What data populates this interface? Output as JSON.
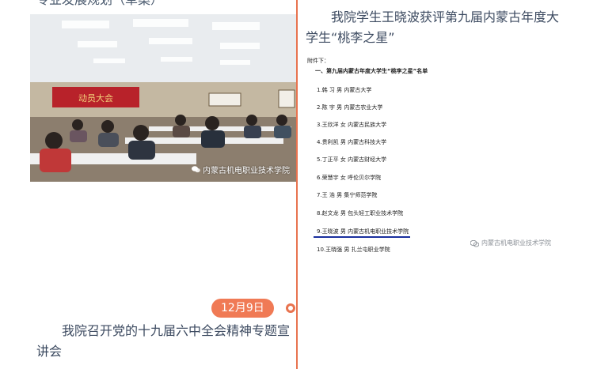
{
  "left_top_clipped_title": "专业发展规划（草案）",
  "left_photo": {
    "watermark": "内蒙古机电职业技术学院",
    "banner_text": "动员大会"
  },
  "right_news": {
    "title": "我院学生王晓波获评第九届内蒙古年度大学生“桃李之星”"
  },
  "document": {
    "header": "附件下：",
    "section": "一、第九届内蒙古年度大学生“桃李之星”名单",
    "entries": [
      "1.韩 习 男   内蒙古大学",
      "2.陈 宇 男   内蒙古农业大学",
      "3.王欣洋 女   内蒙古民族大学",
      "4.贵利凯 男   内蒙古科技大学",
      "5.丁正平 女   内蒙古财经大学",
      "6.荣慧宇 女   呼伦贝尔学院",
      "7.王 浩 男   集宁师范学院",
      "8.赵文龙 男   包头轻工职业技术学院",
      "9.王晓波 男   内蒙古机电职业技术学院",
      "10.王晓强 男 扎兰屯职业学院"
    ],
    "watermark": "内蒙古机电职业技术学院"
  },
  "timeline": {
    "date": "12月9日",
    "accent_color": "#e8734f"
  },
  "left_news": {
    "title": "我院召开党的十九届六中全会精神专题宣讲会"
  }
}
